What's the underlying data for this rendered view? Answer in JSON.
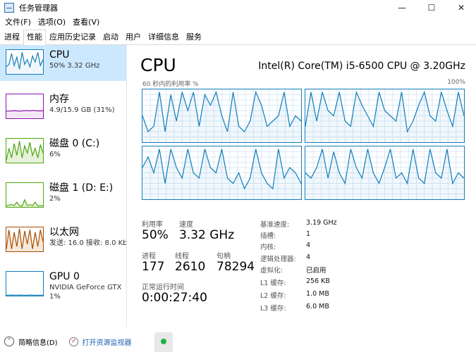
{
  "window": {
    "title": "任务管理器",
    "controls": [
      "—",
      "☐",
      "✕"
    ]
  },
  "menu": [
    "文件(F)",
    "选项(O)",
    "查看(V)"
  ],
  "tabs": [
    {
      "label": "进程",
      "active": false
    },
    {
      "label": "性能",
      "active": true
    },
    {
      "label": "应用历史记录",
      "active": false
    },
    {
      "label": "启动",
      "active": false
    },
    {
      "label": "用户",
      "active": false
    },
    {
      "label": "详细信息",
      "active": false
    },
    {
      "label": "服务",
      "active": false
    }
  ],
  "resources": [
    {
      "name": "CPU",
      "sub": "50%  3.32 GHz",
      "color": "#117dbb",
      "fill": "#f1f6fa",
      "selected": true,
      "values": [
        0.3,
        0.4,
        0.85,
        0.35,
        0.7,
        0.2,
        0.9,
        0.4,
        0.6,
        0.3,
        0.75,
        0.5,
        0.9,
        0.35,
        0.6
      ]
    },
    {
      "name": "内存",
      "sub": "4.9/15.9 GB (31%)",
      "color": "#8b12ae",
      "fill": "#f4e8f7",
      "selected": false,
      "values": [
        0.3,
        0.3,
        0.31,
        0.32,
        0.31,
        0.3,
        0.31,
        0.32,
        0.32,
        0.31,
        0.33,
        0.32,
        0.31,
        0.31,
        0.32
      ]
    },
    {
      "name": "磁盘 0 (C:)",
      "sub": "6%",
      "color": "#4da60c",
      "fill": "#e6f2dc",
      "selected": false,
      "values": [
        0.1,
        0.6,
        0.2,
        0.8,
        0.3,
        0.9,
        0.2,
        0.7,
        0.4,
        0.85,
        0.3,
        0.6,
        0.2,
        0.75,
        0.4
      ]
    },
    {
      "name": "磁盘 1 (D: E:)",
      "sub": "2%",
      "color": "#4da60c",
      "fill": "#e6f2dc",
      "selected": false,
      "values": [
        0.05,
        0.08,
        0.1,
        0.06,
        0.2,
        0.05,
        0.04,
        0.3,
        0.06,
        0.1,
        0.05,
        0.2,
        0.04,
        0.06,
        0.05
      ]
    },
    {
      "name": "以太网",
      "sub": "发送: 16.0  接收: 8.0 Kb",
      "color": "#a74f01",
      "fill": "#f7e9dc",
      "selected": false,
      "values": [
        0.1,
        0.9,
        0.1,
        0.8,
        0.2,
        0.95,
        0.1,
        0.85,
        0.3,
        0.9,
        0.1,
        0.8,
        0.2,
        0.9,
        0.4
      ]
    },
    {
      "name": "GPU 0",
      "sub": "NVIDIA GeForce GTX",
      "sub2": "1%",
      "color": "#117dbb",
      "fill": "#ffffff",
      "selected": false,
      "values": [
        0.02,
        0.02,
        0.03,
        0.02,
        0.02,
        0.03,
        0.02,
        0.02,
        0.02,
        0.03,
        0.02,
        0.02,
        0.02,
        0.02,
        0.02
      ]
    }
  ],
  "detail": {
    "title": "CPU",
    "model": "Intel(R) Core(TM) i5-6500 CPU @ 3.20GHz",
    "graph_caption": "60 秒内的利用率 %",
    "graph_max": "100%",
    "line_color": "#117dbb",
    "grid_color": "#d9eaf7",
    "cores": [
      [
        0.5,
        0.2,
        0.3,
        0.95,
        0.2,
        0.9,
        0.4,
        0.95,
        0.6,
        0.95,
        0.3,
        0.9,
        0.7,
        0.95,
        0.5,
        0.2,
        0.95,
        0.3,
        0.2,
        0.4,
        0.95,
        0.7,
        0.3,
        0.4,
        0.5,
        0.95,
        0.3,
        0.5,
        0.4
      ],
      [
        0.3,
        0.95,
        0.4,
        0.95,
        0.6,
        0.5,
        0.95,
        0.4,
        0.3,
        0.95,
        0.7,
        0.5,
        0.3,
        0.95,
        0.6,
        0.5,
        0.4,
        0.95,
        0.2,
        0.4,
        0.7,
        0.95,
        0.5,
        0.4,
        0.95,
        0.6,
        0.3,
        0.95,
        0.5
      ],
      [
        0.6,
        0.8,
        0.5,
        0.95,
        0.3,
        0.95,
        0.6,
        0.4,
        0.95,
        0.5,
        0.4,
        0.95,
        0.6,
        0.5,
        0.95,
        0.4,
        0.3,
        0.5,
        0.2,
        0.4,
        0.95,
        0.5,
        0.3,
        0.2,
        0.95,
        0.4,
        0.6,
        0.5,
        0.3
      ],
      [
        0.5,
        0.4,
        0.6,
        0.95,
        0.4,
        0.9,
        0.5,
        0.3,
        0.95,
        0.6,
        0.4,
        0.95,
        0.5,
        0.3,
        0.6,
        0.95,
        0.4,
        0.5,
        0.3,
        0.95,
        0.4,
        0.3,
        0.95,
        0.5,
        0.4,
        0.95,
        0.3,
        0.5,
        0.4
      ]
    ],
    "stats": {
      "utilization_label": "利用率",
      "utilization": "50%",
      "speed_label": "速度",
      "speed": "3.32 GHz",
      "processes_label": "进程",
      "processes": "177",
      "threads_label": "线程",
      "threads": "2610",
      "handles_label": "句柄",
      "handles": "78294",
      "uptime_label": "正常运行时间",
      "uptime": "0:00:27:40"
    },
    "specs": [
      {
        "key": "基准速度:",
        "val": "3.19 GHz"
      },
      {
        "key": "插槽:",
        "val": "1"
      },
      {
        "key": "内核:",
        "val": "4"
      },
      {
        "key": "逻辑处理器:",
        "val": "4"
      },
      {
        "key": "虚拟化:",
        "val": "已启用"
      },
      {
        "key": "L1 缓存:",
        "val": "256 KB"
      },
      {
        "key": "L2 缓存:",
        "val": "1.0 MB"
      },
      {
        "key": "L3 缓存:",
        "val": "6.0 MB"
      }
    ]
  },
  "footer": {
    "fewer_details": "简略信息(D)",
    "open_monitor": "打开资源监视器"
  }
}
